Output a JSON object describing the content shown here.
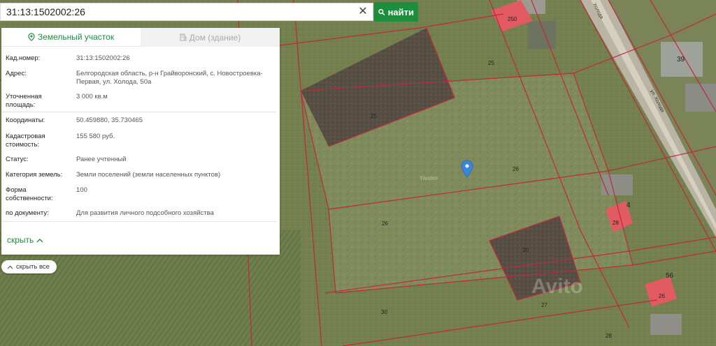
{
  "search": {
    "value": "31:13:1502002:26",
    "button_label": "найти"
  },
  "tabs": [
    {
      "label": "Земельный участок",
      "icon": "map-pin-icon",
      "active": true
    },
    {
      "label": "Дом (здание)",
      "icon": "building-icon",
      "active": false
    }
  ],
  "details": [
    {
      "label": "Кад.номер:",
      "value": "31:13:1502002:26"
    },
    {
      "label": "Адрес:",
      "value": "Белгородская область, р-н Грайворонский, с. Новостроевка-Первая, ул. Холода, 50а"
    },
    {
      "label": "Уточненная площадь:",
      "value": "3 000 кв.м"
    },
    {
      "label": "Координаты:",
      "value": "50.459880, 35.730465"
    },
    {
      "label": "Кадастровая стоимость:",
      "value": "155 580 руб."
    },
    {
      "label": "Статус:",
      "value": "Ранее учтенный"
    },
    {
      "label": "Категория земель:",
      "value": "Земли поселений (земли населенных пунктов)"
    },
    {
      "label": "Форма собственности:",
      "value": "100"
    },
    {
      "label": "по документу:",
      "value": "Для развития личного подсобного хозяйства"
    }
  ],
  "hide_label": "скрыть",
  "hide_all_label": "скрыть все",
  "map": {
    "plot_numbers": [
      "25",
      "25",
      "26",
      "26",
      "30",
      "30",
      "27",
      "28",
      "56",
      "39",
      "4",
      "250",
      "28",
      "26"
    ],
    "street_label": "ул. Холода",
    "road_label": "Холода",
    "map_provider": "Yandex",
    "watermark": "Avito"
  },
  "colors": {
    "accent": "#1c8f3c",
    "boundary": "#c2273a",
    "marker": "#3c86d9"
  }
}
